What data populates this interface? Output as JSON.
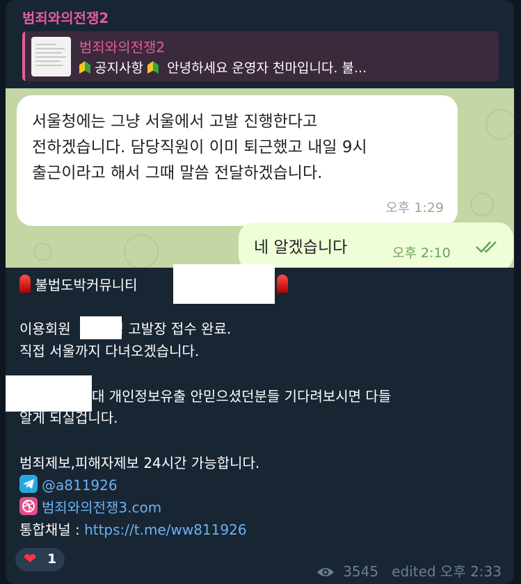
{
  "sender": "범죄와의전쟁2",
  "reply": {
    "name": "범죄와의전쟁2",
    "text_a": "공지사항",
    "text_b": "안녕하세요 운영자 천마입니다. 불..."
  },
  "screenshot": {
    "incoming_text": "서울청에는 그냥 서울에서 고발 진행한다고\n전하겠습니다. 담당직원이 이미 퇴근했고 내일 9시\n출근이라고 해서 그때 말씀 전달하겠습니다.",
    "incoming_time": "오후 1:29",
    "outgoing_text": "네 알겠습니다",
    "outgoing_time": "오후 2:10"
  },
  "body": {
    "line1": "불법도박커뮤니티",
    "line2_a": "이용회원",
    "line2_b": "명 고발장 접수 완료.",
    "line3": "직접 서울까지 다녀오겠습니다.",
    "line4": "대 개인정보유출 안믿으셨던분들 기다려보시면 다들",
    "line5": "알게 되실겁니다.",
    "line6": "범죄제보,피해자제보 24시간 가능합니다.",
    "telegram_handle": "@a811926",
    "site_link": "범죄와의전쟁3.com",
    "channel_label": "통합채널 : ",
    "channel_link": "https://t.me/ww811926"
  },
  "reaction": {
    "emoji": "❤",
    "count": "1"
  },
  "meta": {
    "views": "3545",
    "edited": "edited 오후 2:33"
  },
  "icons": {
    "reply_leaf": "beginner-leaf-icon",
    "siren": "siren-icon",
    "telegram": "telegram-icon",
    "dribbble": "dribbble-icon",
    "views": "eye-icon",
    "read": "double-check-icon"
  }
}
